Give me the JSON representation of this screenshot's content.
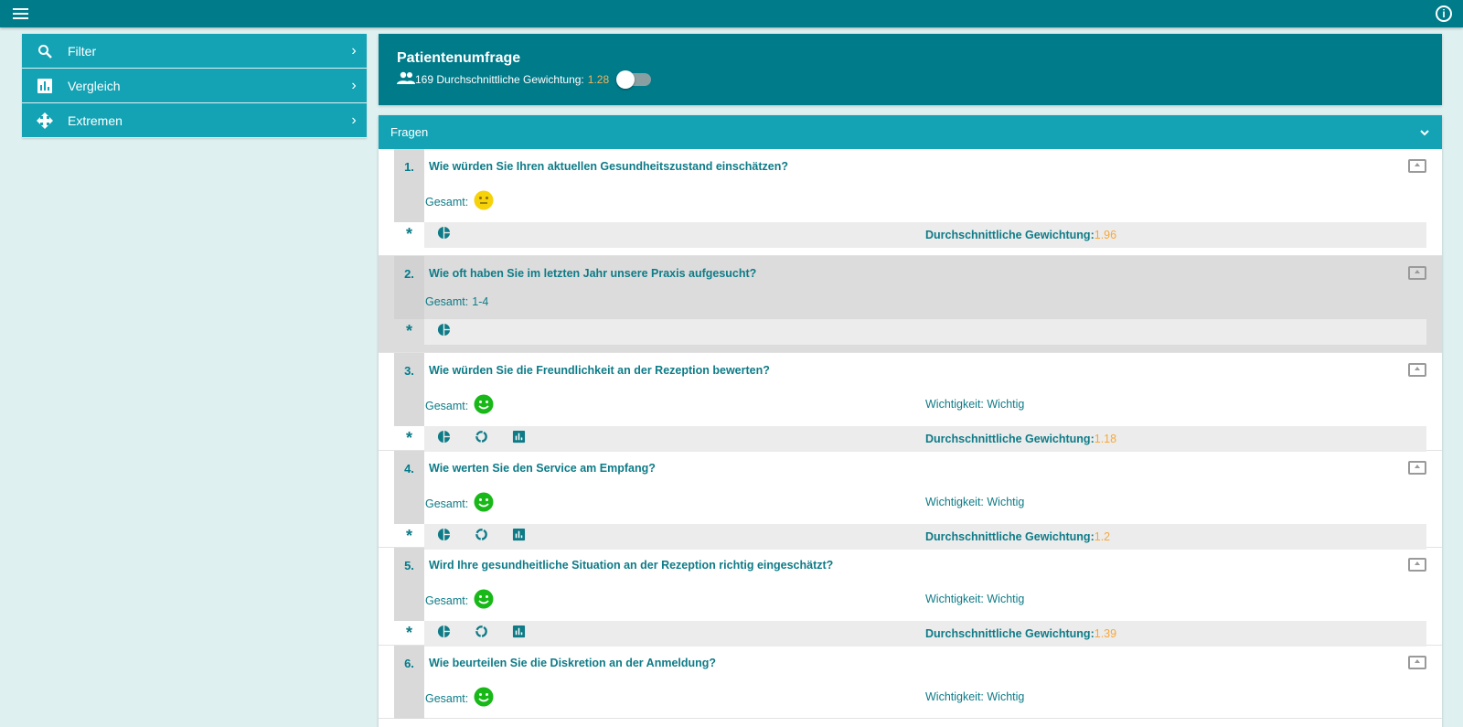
{
  "topbar": {
    "menu_icon": "menu-icon",
    "info_icon": "info-icon",
    "info_glyph": "i",
    "color": "#007b8a"
  },
  "sidebar": {
    "items": [
      {
        "label": "Filter",
        "icon": "search-icon"
      },
      {
        "label": "Vergleich",
        "icon": "bar-chart-icon"
      },
      {
        "label": "Extremen",
        "icon": "move-arrows-icon"
      }
    ],
    "chevron": "›"
  },
  "header": {
    "title": "Patientenumfrage",
    "count_text": "169 Durchschnittliche Gewichtung:",
    "avg_value": "1.28",
    "people_icon": "people-icon",
    "toggle_on": false
  },
  "panel": {
    "title": "Fragen",
    "chevron_icon": "chevron-down-icon"
  },
  "questions": [
    {
      "num": "1.",
      "title": "Wie würden Sie Ihren aktuellen Gesundheitszustand einschätzen?",
      "gesamt_label": "Gesamt:",
      "gesamt_value": "",
      "smiley": "neutral",
      "importance": "",
      "icons": [
        "pie-chart-icon"
      ],
      "avg_label": "Durchschnittliche Gewichtung:",
      "avg_value": "1.96",
      "highlight": false
    },
    {
      "num": "2.",
      "title": "Wie oft haben Sie im letzten Jahr unsere Praxis aufgesucht?",
      "gesamt_label": "Gesamt:",
      "gesamt_value": "1-4",
      "smiley": "none",
      "importance": "",
      "icons": [
        "pie-chart-icon"
      ],
      "avg_label": "",
      "avg_value": "",
      "highlight": true
    },
    {
      "num": "3.",
      "title": "Wie würden Sie die Freundlichkeit an der Rezeption bewerten?",
      "gesamt_label": "Gesamt:",
      "gesamt_value": "",
      "smiley": "happy",
      "importance": "Wichtigkeit: Wichtig",
      "icons": [
        "pie-chart-icon",
        "donut-chart-icon",
        "bar-chart-icon"
      ],
      "avg_label": "Durchschnittliche Gewichtung:",
      "avg_value": "1.18",
      "highlight": false
    },
    {
      "num": "4.",
      "title": "Wie werten Sie den Service am Empfang?",
      "gesamt_label": "Gesamt:",
      "gesamt_value": "",
      "smiley": "happy",
      "importance": "Wichtigkeit: Wichtig",
      "icons": [
        "pie-chart-icon",
        "donut-chart-icon",
        "bar-chart-icon"
      ],
      "avg_label": "Durchschnittliche Gewichtung:",
      "avg_value": "1.2",
      "highlight": false
    },
    {
      "num": "5.",
      "title": "Wird Ihre gesundheitliche Situation an der Rezeption richtig eingeschätzt?",
      "gesamt_label": "Gesamt:",
      "gesamt_value": "",
      "smiley": "happy",
      "importance": "Wichtigkeit: Wichtig",
      "icons": [
        "pie-chart-icon",
        "donut-chart-icon",
        "bar-chart-icon"
      ],
      "avg_label": "Durchschnittliche Gewichtung:",
      "avg_value": "1.39",
      "highlight": false
    },
    {
      "num": "6.",
      "title": "Wie beurteilen Sie die Diskretion an der Anmeldung?",
      "gesamt_label": "Gesamt:",
      "gesamt_value": "",
      "smiley": "happy",
      "importance": "Wichtigkeit: Wichtig",
      "icons": [],
      "avg_label": "",
      "avg_value": "",
      "highlight": false
    }
  ],
  "row_star": "*",
  "colors": {
    "teal_dark": "#007b8a",
    "teal_light": "#13a3b5",
    "accent": "#f7a83a",
    "happy": "#19b819",
    "neutral": "#f5d20a"
  }
}
